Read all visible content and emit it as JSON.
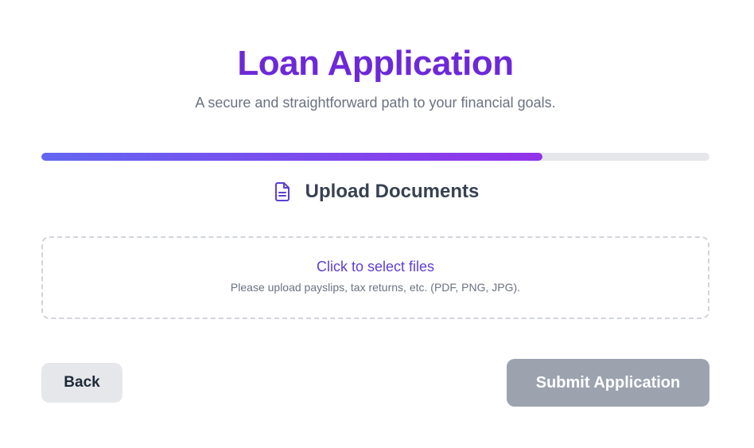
{
  "header": {
    "title": "Loan Application",
    "subtitle": "A secure and straightforward path to your financial goals."
  },
  "progress": {
    "fraction": 0.75,
    "fill_start_color": "#6366f1",
    "fill_end_color": "#9333ea",
    "track_color": "#e5e7eb"
  },
  "step": {
    "icon": "document-icon",
    "title": "Upload Documents"
  },
  "upload": {
    "link_text": "Click to select files",
    "hint": "Please upload payslips, tax returns, etc. (PDF, PNG, JPG)."
  },
  "actions": {
    "back_label": "Back",
    "submit_label": "Submit Application",
    "submit_disabled": true
  },
  "colors": {
    "accent": "#6d28d9",
    "link": "#5b3fd6",
    "muted_text": "#6b7280",
    "disabled_button": "#9ca3af"
  }
}
